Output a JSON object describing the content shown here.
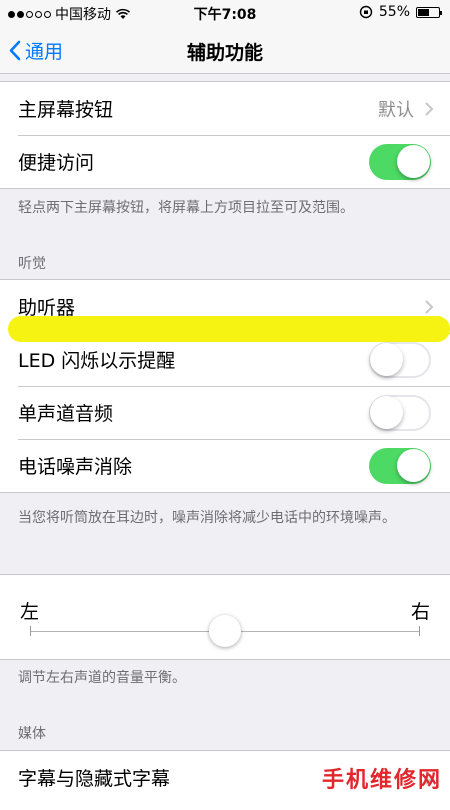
{
  "status_bar": {
    "carrier": "中国移动",
    "time": "下午7:08",
    "battery_percent": "55%",
    "battery_level": 0.55
  },
  "nav": {
    "back_label": "通用",
    "title": "辅助功能"
  },
  "group_home": {
    "home_button": {
      "label": "主屏幕按钮",
      "value": "默认"
    },
    "reachability": {
      "label": "便捷访问",
      "on": true
    },
    "footer": "轻点两下主屏幕按钮，将屏幕上方项目拉至可及范围。"
  },
  "hearing": {
    "header": "听觉",
    "hearing_aids": {
      "label": "助听器"
    },
    "led_flash": {
      "label": "LED 闪烁以示提醒",
      "on": false
    },
    "mono_audio": {
      "label": "单声道音频",
      "on": false
    },
    "noise_cancellation": {
      "label": "电话噪声消除",
      "on": true
    },
    "footer": "当您将听筒放在耳边时，噪声消除将减少电话中的环境噪声。"
  },
  "balance": {
    "left_label": "左",
    "right_label": "右",
    "value": 0.5,
    "footer": "调节左右声道的音量平衡。"
  },
  "media": {
    "header": "媒体",
    "subtitles": {
      "label": "字幕与隐藏式字幕"
    }
  },
  "watermark": "手机维修网",
  "colors": {
    "accent": "#007aff",
    "switch_on": "#4cd964",
    "highlighter": "#f6f312",
    "watermark": "#e2262c"
  }
}
